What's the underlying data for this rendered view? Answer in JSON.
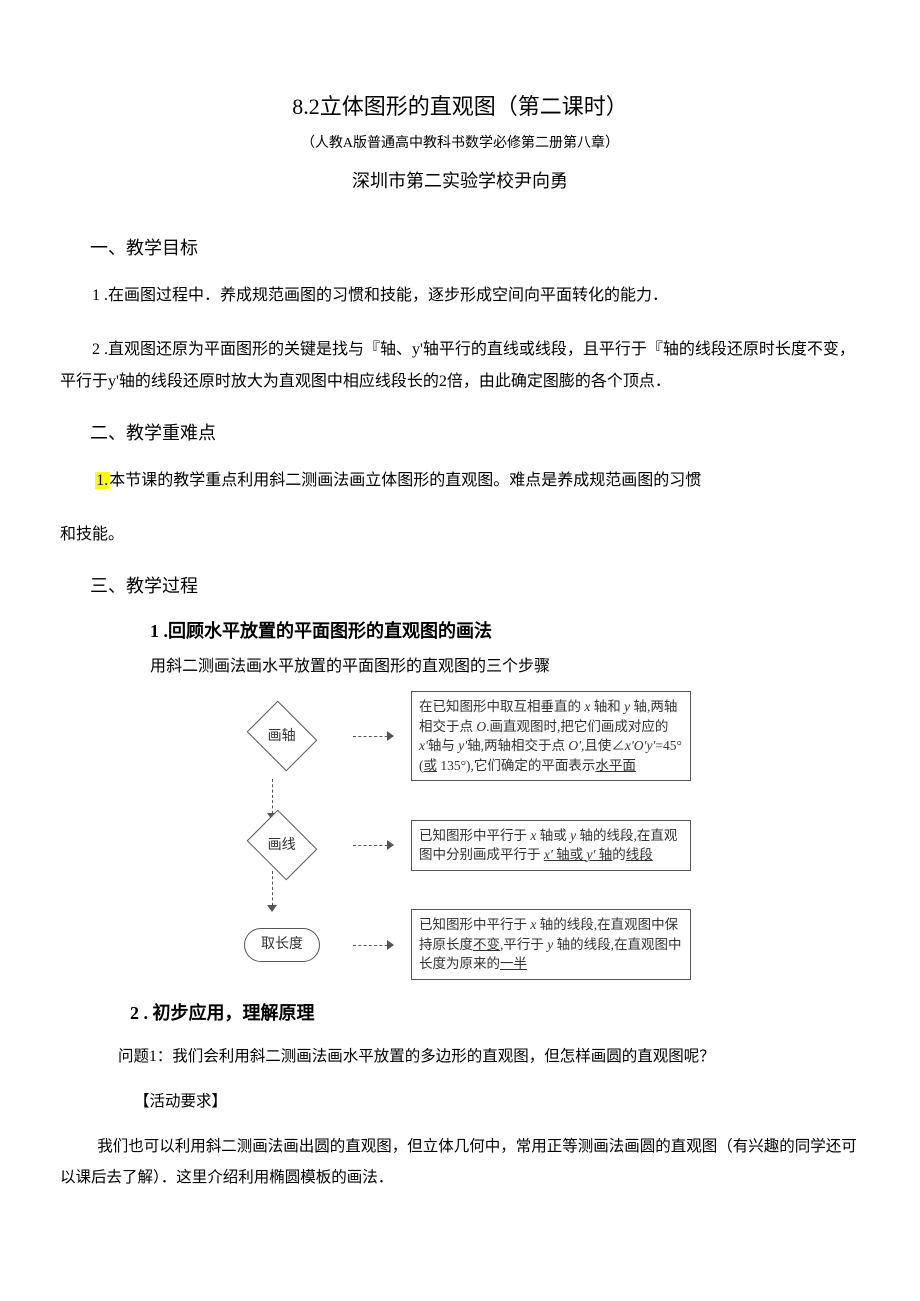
{
  "title": "8.2立体图形的直观图（第二课时）",
  "subtitle": "（人教A版普通高中教科书数学必修第二册第八章）",
  "author": "深圳市第二实验学校尹向勇",
  "sec1": {
    "heading": "一、教学目标",
    "p1": "1 .在画图过程中．养成规范画图的习惯和技能，逐步形成空间向平面转化的能力．",
    "p2": "2 .直观图还原为平面图形的关键是找与『轴、y'轴平行的直线或线段，且平行于『轴的线段还原时长度不变，平行于y'轴的线段还原时放大为直观图中相应线段长的2倍，由此确定图膨的各个顶点．"
  },
  "sec2": {
    "heading": "二、教学重难点",
    "hl": "1.",
    "p1a": "本节课的教学重点利用斜二测画法画立体图形的直观图。难点是养成规范画图的习惯",
    "p1b": "和技能。"
  },
  "sec3": {
    "heading": "三、教学过程",
    "s1_title": "1 .回顾水平放置的平面图形的直观图的画法",
    "s1_note": "用斜二测画法画水平放置的平面图形的直观图的三个步骤",
    "flow": {
      "n1": "画轴",
      "d1": "在已知图形中取互相垂直的 x 轴和 y 轴,两轴相交于点 O.画直观图时,把它们画成对应的 x'轴与 y'轴,两轴相交于点 O',且使∠x'O'y'=45°(或 135°),它们确定的平面表示水平面",
      "n2": "画线",
      "d2": "已知图形中平行于 x 轴或 y 轴的线段,在直观图中分别画成平行于 x' 轴或 y' 轴的线段",
      "n3": "取长度",
      "d3": "已知图形中平行于 x 轴的线段,在直观图中保持原长度不变,平行于 y 轴的线段,在直观图中长度为原来的一半"
    },
    "s2_title": "2  . 初步应用，理解原理",
    "q1": "问题1：我们会利用斜二测画法画水平放置的多边形的直观图，但怎样画圆的直观图呢？",
    "activity": "【活动要求】",
    "para": "我们也可以利用斜二测画法画出圆的直观图，但立体几何中，常用正等测画法画圆的直观图（有兴趣的同学还可以课后去了解）．这里介绍利用椭圆模板的画法．"
  }
}
